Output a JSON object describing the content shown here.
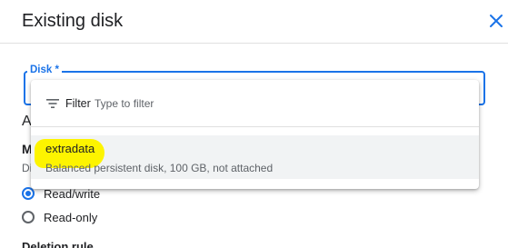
{
  "dialog": {
    "title": "Existing disk",
    "close_icon": "close-icon"
  },
  "colors": {
    "accent": "#1a73e8",
    "highlight": "#fdf400",
    "option_hover_bg": "#f1f3f4"
  },
  "disk_field": {
    "label": "Disk *"
  },
  "dropdown": {
    "filter_icon": "filter-list-icon",
    "filter_label": "Filter",
    "filter_placeholder": "Type to filter",
    "options": [
      {
        "name": "extradata",
        "description": "Balanced persistent disk, 100 GB, not attached",
        "highlighted": true
      }
    ]
  },
  "background_form": {
    "heading_partial": "A",
    "mode_label_partial": "M",
    "mode_desc_partial": "Di",
    "radios": [
      {
        "label": "Read/write",
        "checked": true
      },
      {
        "label": "Read-only",
        "checked": false
      }
    ],
    "deletion_rule_label": "Deletion rule"
  }
}
